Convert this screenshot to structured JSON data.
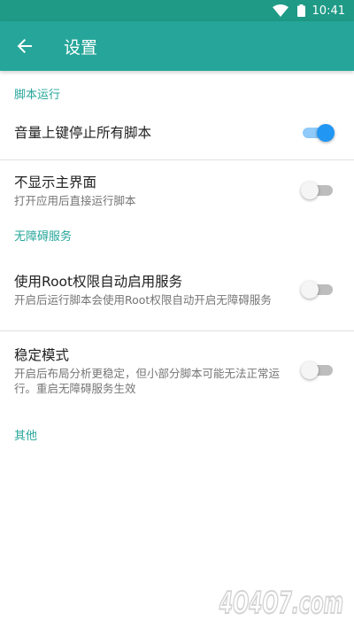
{
  "status_bar": {
    "time": "10:41"
  },
  "app_bar": {
    "title": "设置"
  },
  "sections": {
    "script_run": {
      "header": "脚本运行",
      "volume_stop": {
        "title": "音量上键停止所有脚本",
        "enabled": true
      },
      "hide_main": {
        "title": "不显示主界面",
        "summary": "打开应用后直接运行脚本",
        "enabled": false
      }
    },
    "accessibility": {
      "header": "无障碍服务",
      "root_enable": {
        "title": "使用Root权限自动启用服务",
        "summary": "开启后运行脚本会使用Root权限自动开启无障碍服务",
        "enabled": false
      },
      "stable_mode": {
        "title": "稳定模式",
        "summary": "开启后布局分析更稳定，但小部分脚本可能无法正常运行。重启无障碍服务生效",
        "enabled": false
      }
    },
    "other": {
      "header": "其他"
    }
  },
  "watermark": {
    "text": "4O4O7.com"
  },
  "colors": {
    "primary": "#26a69a",
    "status": "#1f9a86",
    "accent": "#2196f3"
  }
}
